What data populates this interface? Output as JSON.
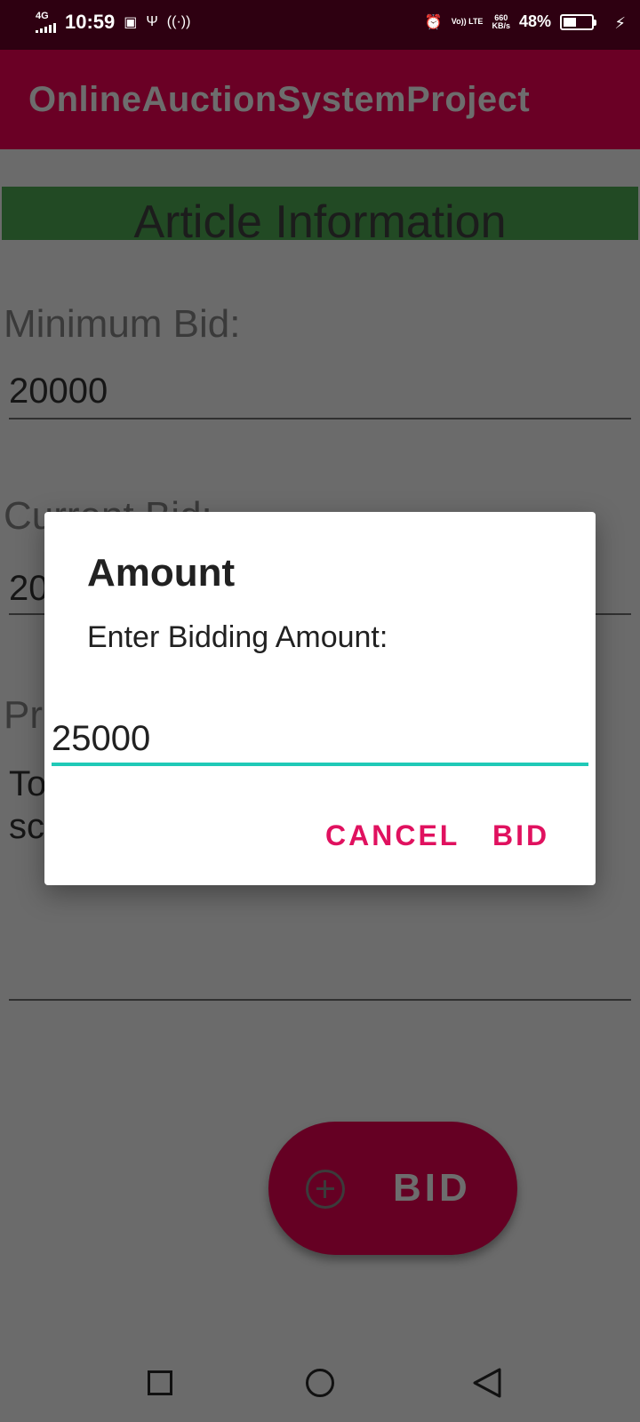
{
  "status_bar": {
    "network": "4G",
    "time": "10:59",
    "volte": "Vo)) LTE",
    "speed_value": "660",
    "speed_unit": "KB/s",
    "battery": "48%",
    "battery_level": 0.48
  },
  "app_bar": {
    "title": "OnlineAuctionSystemProject"
  },
  "content": {
    "header": "Article Information",
    "minimum_bid_label": "Minimum Bid:",
    "minimum_bid_value": "20000",
    "current_bid_label": "Current Bid:",
    "current_bid_value": "20",
    "product_label": "Pr",
    "product_value_line1": "To",
    "product_value_line2": "sc"
  },
  "dialog": {
    "title": "Amount",
    "message": "Enter Bidding Amount:",
    "input_value": "25000",
    "cancel_label": "CANCEL",
    "bid_label": "BID",
    "accent_color": "#e0115f",
    "input_underline_color": "#20c9b7"
  },
  "fab": {
    "label": "BID",
    "icon": "add-circle-icon"
  },
  "nav_bar": {
    "icons": [
      "recents-square-icon",
      "home-circle-icon",
      "back-triangle-icon"
    ]
  }
}
